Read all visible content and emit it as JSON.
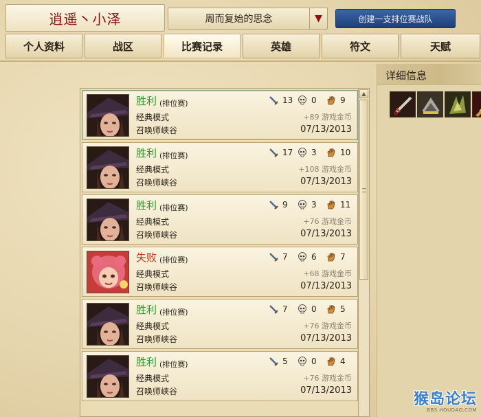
{
  "header": {
    "summoner_name": "逍遥丶小泽",
    "season_select": "周而复始的思念",
    "create_team_button": "创建一支排位赛战队"
  },
  "tabs": [
    {
      "label": "个人资料",
      "active": false
    },
    {
      "label": "战区",
      "active": false
    },
    {
      "label": "比赛记录",
      "active": true
    },
    {
      "label": "英雄",
      "active": false
    },
    {
      "label": "符文",
      "active": false
    },
    {
      "label": "天赋",
      "active": false
    }
  ],
  "side_panel": {
    "title": "详细信息",
    "items": [
      "sword-item-icon",
      "helm-item-icon",
      "claw-item-icon",
      "blade-item-icon"
    ]
  },
  "matches": [
    {
      "result": "胜利",
      "outcome": "win",
      "queue": "(排位赛)",
      "mode": "经典模式",
      "map": "召唤师峡谷",
      "kills": "13",
      "deaths": "0",
      "assists": "9",
      "gold": "+89 游戏金币",
      "date": "07/13/2013",
      "champion": "caitlyn"
    },
    {
      "result": "胜利",
      "outcome": "win",
      "queue": "(排位赛)",
      "mode": "经典模式",
      "map": "召唤师峡谷",
      "kills": "17",
      "deaths": "3",
      "assists": "10",
      "gold": "+108 游戏金币",
      "date": "07/13/2013",
      "champion": "caitlyn"
    },
    {
      "result": "胜利",
      "outcome": "win",
      "queue": "(排位赛)",
      "mode": "经典模式",
      "map": "召唤师峡谷",
      "kills": "9",
      "deaths": "3",
      "assists": "11",
      "gold": "+76 游戏金币",
      "date": "07/13/2013",
      "champion": "caitlyn"
    },
    {
      "result": "失败",
      "outcome": "loss",
      "queue": "(排位赛)",
      "mode": "经典模式",
      "map": "召唤师峡谷",
      "kills": "7",
      "deaths": "6",
      "assists": "7",
      "gold": "+68 游戏金币",
      "date": "07/13/2013",
      "champion": "annie"
    },
    {
      "result": "胜利",
      "outcome": "win",
      "queue": "(排位赛)",
      "mode": "经典模式",
      "map": "召唤师峡谷",
      "kills": "7",
      "deaths": "0",
      "assists": "5",
      "gold": "+76 游戏金币",
      "date": "07/13/2013",
      "champion": "caitlyn"
    },
    {
      "result": "胜利",
      "outcome": "win",
      "queue": "(排位赛)",
      "mode": "经典模式",
      "map": "召唤师峡谷",
      "kills": "5",
      "deaths": "0",
      "assists": "4",
      "gold": "+76 游戏金币",
      "date": "07/13/2013",
      "champion": "caitlyn"
    }
  ],
  "watermark": {
    "main": "猴岛论坛",
    "sub": "BBS.HOUDAO.COM"
  },
  "colors": {
    "win": "#2f9b2f",
    "loss": "#c23a1a",
    "summoner_name": "#8a1414",
    "button_blue": "#1f3f78"
  }
}
